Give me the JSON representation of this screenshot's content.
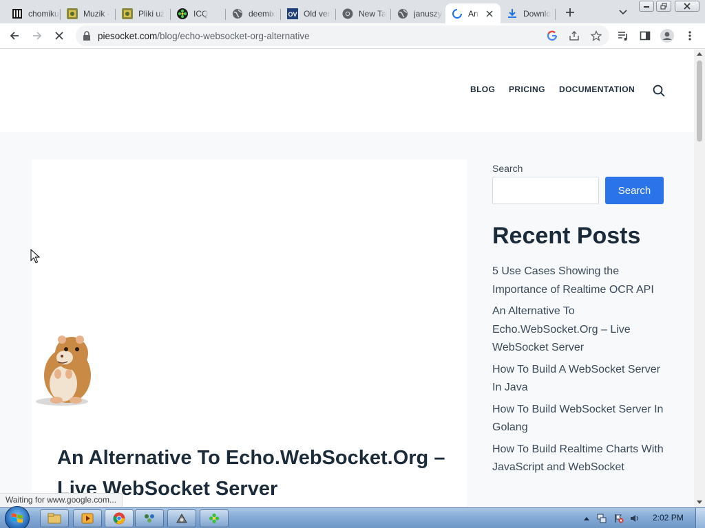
{
  "browser": {
    "tabs": [
      {
        "title": "chomikuj",
        "icon": "library-icon"
      },
      {
        "title": "Muzik -",
        "icon": "puzzle-icon"
      },
      {
        "title": "Pliki uż",
        "icon": "puzzle-icon"
      },
      {
        "title": "ICQ",
        "icon": "icq-flower-icon"
      },
      {
        "title": "deemix",
        "icon": "globe-icon"
      },
      {
        "title": "Old ver",
        "icon": "ov-icon"
      },
      {
        "title": "New Ta",
        "icon": "chrome-icon"
      },
      {
        "title": "januszy",
        "icon": "globe-icon"
      },
      {
        "title": "An",
        "icon": "loading-spinner-icon",
        "active": true
      },
      {
        "title": "Downlo",
        "icon": "download-icon"
      }
    ],
    "url": {
      "host": "piesocket.com",
      "path": "/blog/echo-websocket-org-alternative"
    },
    "status_text": "Waiting for www.google.com...",
    "accent": "#1a73e8"
  },
  "site": {
    "nav": [
      "BLOG",
      "PRICING",
      "DOCUMENTATION"
    ],
    "post_title": "An Alternative To Echo.WebSocket.Org – Live WebSocket Server",
    "sidebar": {
      "search_label": "Search",
      "search_button": "Search",
      "search_placeholder": "",
      "recent_title": "Recent Posts",
      "recent_posts": [
        "5 Use Cases Showing the Importance of Realtime OCR API",
        "An Alternative To Echo.WebSocket.Org – Live WebSocket Server",
        "How To Build A WebSocket Server In Java",
        "How To Build WebSocket Server In Golang",
        "How To Build Realtime Charts With JavaScript and WebSocket"
      ]
    },
    "button_color": "#2a73e8",
    "heading_color": "#1c2b3a"
  },
  "taskbar": {
    "items": [
      "explorer-icon",
      "media-player-icon",
      "chrome-icon",
      "network-icon",
      "app-icon",
      "icq-icon"
    ],
    "clock": "2:02 PM"
  }
}
